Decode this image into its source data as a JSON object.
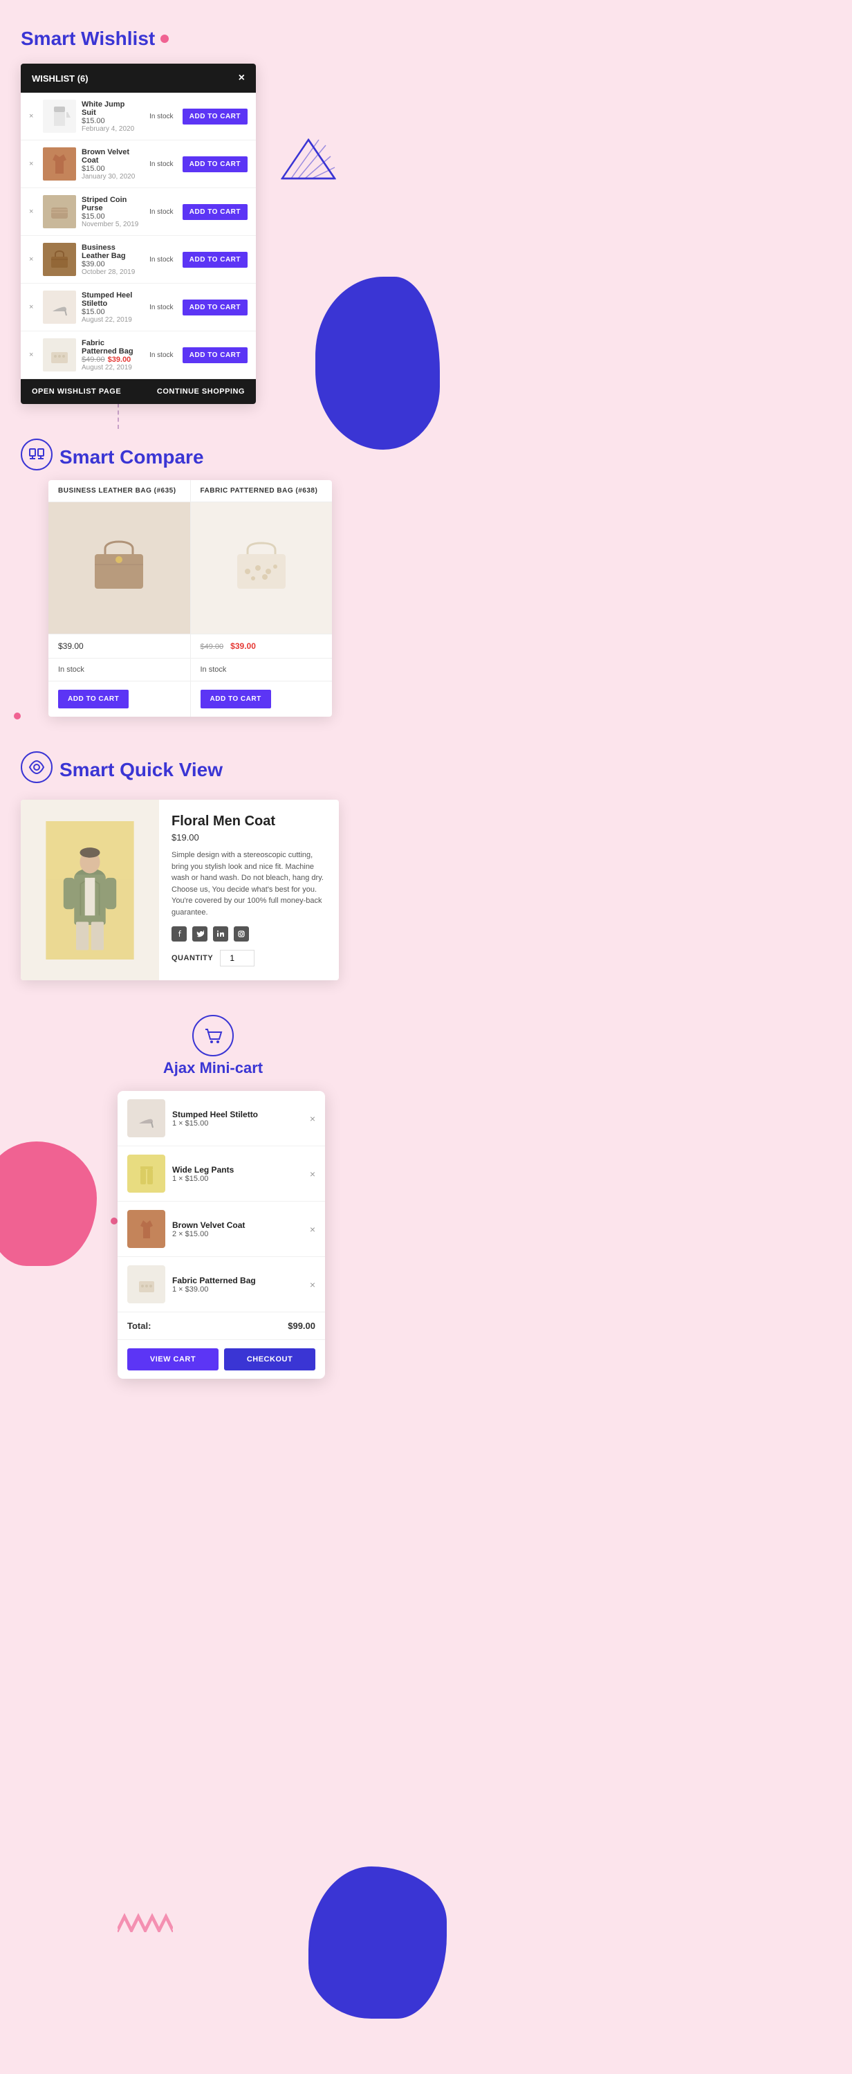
{
  "page": {
    "background": "#fce4ec"
  },
  "sections": {
    "wishlist": {
      "title": "Smart Wishlist",
      "panel": {
        "header": "WISHLIST (6)",
        "close_label": "×",
        "items": [
          {
            "name": "White Jump Suit",
            "price": "$15.00",
            "date": "February 4, 2020",
            "status": "In stock",
            "btn_label": "ADD TO CART",
            "color": "#e8e8e8"
          },
          {
            "name": "Brown Velvet Coat",
            "price": "$15.00",
            "date": "January 30, 2020",
            "status": "In stock",
            "btn_label": "ADD TO CART",
            "color": "#c4845a"
          },
          {
            "name": "Striped Coin Purse",
            "price": "$15.00",
            "date": "November 5, 2019",
            "status": "In stock",
            "btn_label": "ADD TO CART",
            "color": "#c9b89a"
          },
          {
            "name": "Business Leather Bag",
            "price": "$39.00",
            "date": "October 28, 2019",
            "status": "In stock",
            "btn_label": "ADD TO CART",
            "color": "#8a5c2c"
          },
          {
            "name": "Stumped Heel Stiletto",
            "price": "$15.00",
            "date": "August 22, 2019",
            "status": "In stock",
            "btn_label": "ADD TO CART",
            "color": "#e8e0d8"
          },
          {
            "name": "Fabric Patterned Bag",
            "price_old": "$49.00",
            "price": "$39.00",
            "date": "August 22, 2019",
            "status": "In stock",
            "btn_label": "ADD TO CART",
            "color": "#f0ece4"
          }
        ],
        "footer_open": "OPEN WISHLIST PAGE",
        "footer_continue": "CONTINUE SHOPPING"
      }
    },
    "compare": {
      "title": "Smart Compare",
      "panel": {
        "columns": [
          {
            "header": "BUSINESS LEATHER BAG (#635)",
            "price": "$39.00",
            "status": "In stock",
            "btn_label": "ADD TO CART",
            "color": "#d4a574"
          },
          {
            "header": "FABRIC PATTERNED BAG (#638)",
            "price_old": "$49.00",
            "price": "$39.00",
            "status": "In stock",
            "btn_label": "ADD TO CART",
            "color": "#e8e0d0"
          }
        ]
      }
    },
    "quickview": {
      "title": "Smart Quick View",
      "panel": {
        "product_name": "Floral Men Coat",
        "price": "$19.00",
        "description": "Simple design with a stereoscopic cutting, bring you stylish look and nice fit. Machine wash or hand wash. Do not bleach, hang dry. Choose us, You decide what's best for you. You're covered by our 100% full money-back guarantee.",
        "quantity_label": "QUANTITY",
        "quantity_value": "1",
        "social": [
          "facebook",
          "twitter",
          "linkedin",
          "instagram"
        ]
      }
    },
    "minicart": {
      "title": "Ajax Mini-cart",
      "panel": {
        "items": [
          {
            "name": "Stumped Heel Stiletto",
            "qty": "1",
            "price": "$15.00",
            "color": "#e0d8d0"
          },
          {
            "name": "Wide Leg Pants",
            "qty": "1",
            "price": "$15.00",
            "color": "#d4c84a"
          },
          {
            "name": "Brown Velvet Coat",
            "qty": "2",
            "price": "$15.00",
            "color": "#c4845a"
          },
          {
            "name": "Fabric Patterned Bag",
            "qty": "1",
            "price": "$39.00",
            "color": "#f0ece4"
          }
        ],
        "total_label": "Total:",
        "total_amount": "$99.00",
        "view_cart_label": "VIEW CART",
        "checkout_label": "CHECKOUT"
      }
    }
  }
}
